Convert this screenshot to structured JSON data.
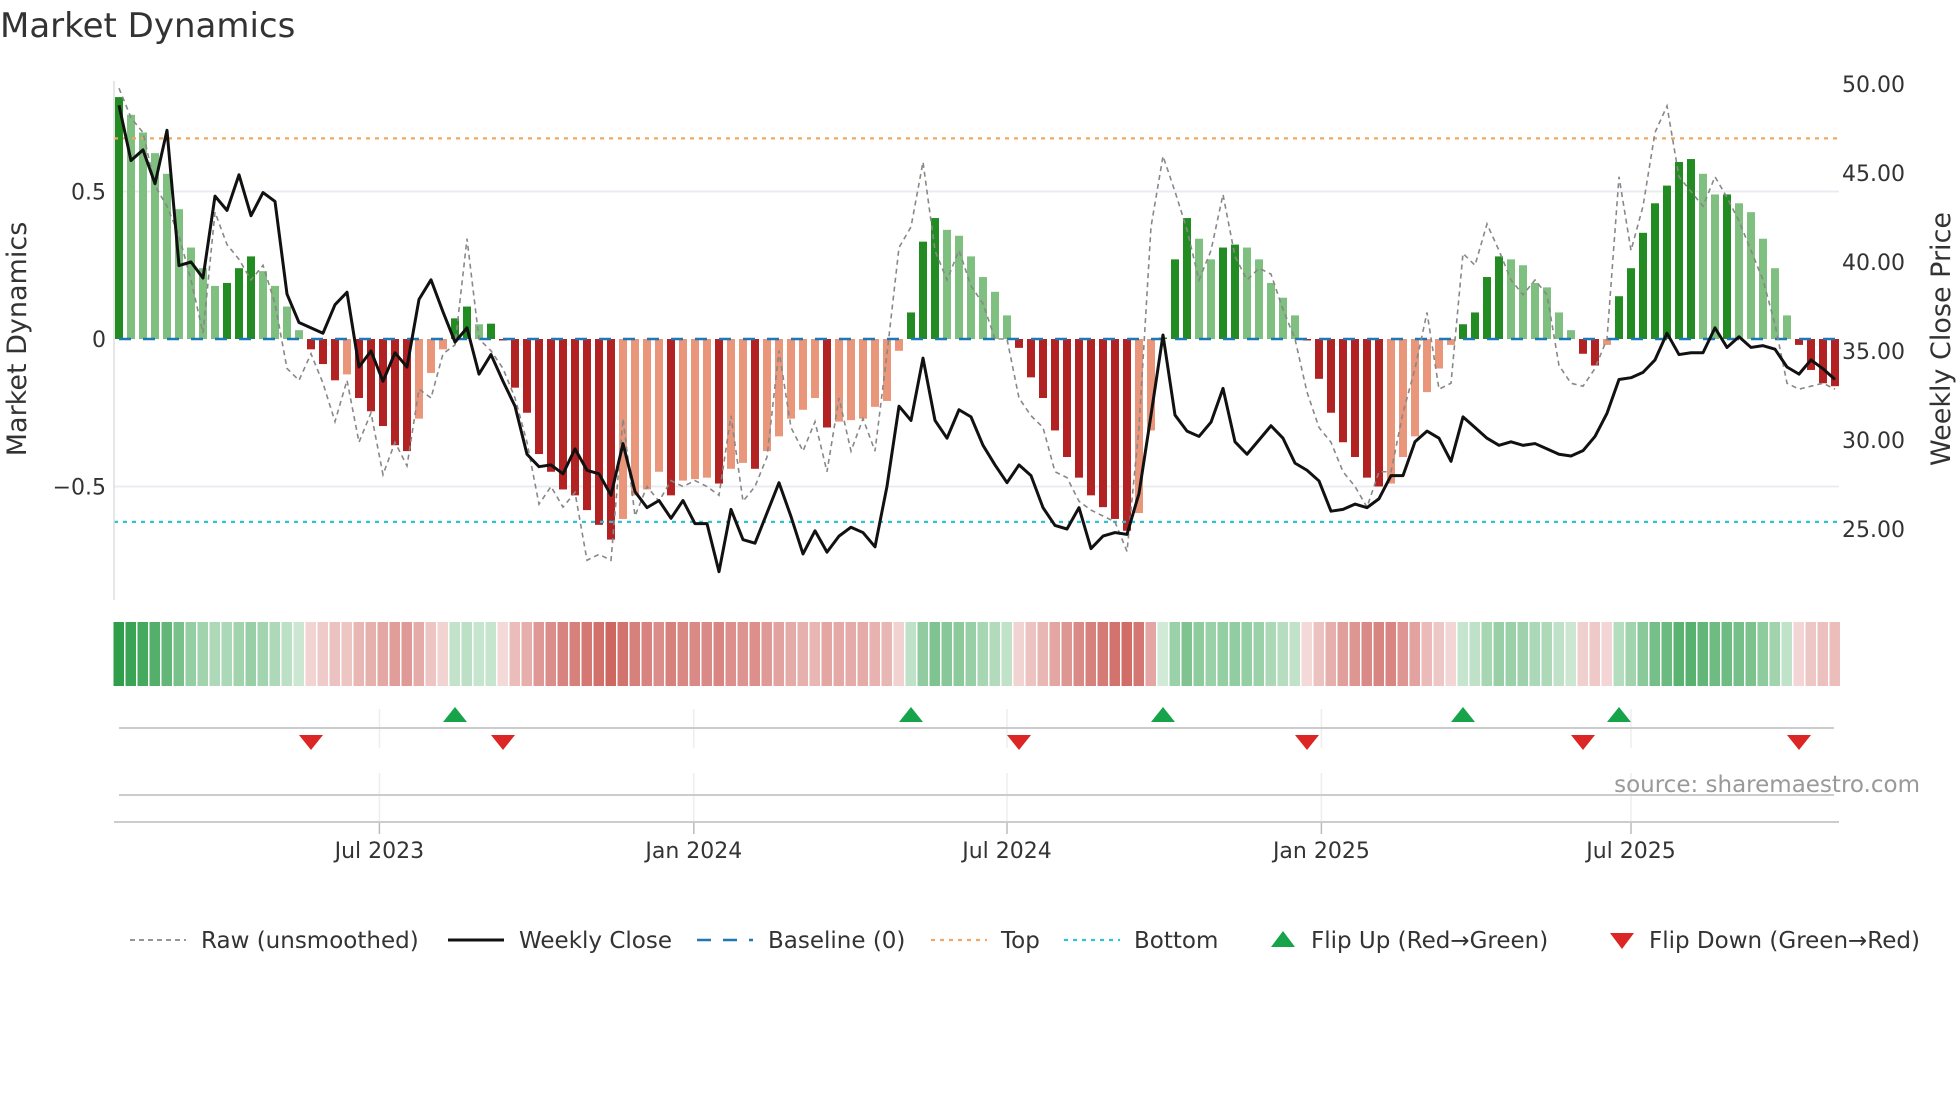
{
  "title": "Market Dynamics",
  "source": "source: sharemaestro.com",
  "colors": {
    "dark_green": "#228b22",
    "light_green": "#7fbf7f",
    "dark_red": "#b22222",
    "light_red": "#e9967a",
    "heat_green": "#2e9e4a",
    "heat_red": "#c8504a",
    "top": "#f0a860",
    "bottom": "#2ec4d6",
    "baseline": "#1f77b4",
    "flip_up": "#16a34a",
    "flip_down": "#dc2626"
  },
  "chart_data": {
    "type": "bar",
    "title": "Market Dynamics",
    "ylabel": "Market Dynamics",
    "y2label": "Weekly Close Price",
    "ylim": [
      -0.94,
      0.87
    ],
    "y2lim": [
      21.6,
      50.2
    ],
    "yticks": [
      {
        "v": 0.5,
        "label": "0.5"
      },
      {
        "v": 0,
        "label": "0"
      },
      {
        "v": -0.5,
        "label": "−0.5"
      }
    ],
    "y2ticks": [
      {
        "v": 50,
        "label": "50.00"
      },
      {
        "v": 45,
        "label": "45.00"
      },
      {
        "v": 40,
        "label": "40.00"
      },
      {
        "v": 35,
        "label": "35.00"
      },
      {
        "v": 30,
        "label": "30.00"
      },
      {
        "v": 25,
        "label": "25.00"
      }
    ],
    "xticks": [
      {
        "week": 22.7,
        "label": "Jul 2023"
      },
      {
        "week": 48.9,
        "label": "Jan 2024"
      },
      {
        "week": 75.0,
        "label": "Jul 2024"
      },
      {
        "week": 101.2,
        "label": "Jan 2025"
      },
      {
        "week": 127.0,
        "label": "Jul 2025"
      }
    ],
    "top_level": 0.68,
    "bottom_level": -0.62,
    "baseline": 0,
    "momentum": [
      0.82,
      0.76,
      0.7,
      0.63,
      0.56,
      0.44,
      0.31,
      0.24,
      0.18,
      0.19,
      0.24,
      0.28,
      0.23,
      0.18,
      0.11,
      0.03,
      -0.035,
      -0.085,
      -0.14,
      -0.12,
      -0.2,
      -0.245,
      -0.295,
      -0.36,
      -0.38,
      -0.27,
      -0.115,
      -0.035,
      0.07,
      0.11,
      0.05,
      0.052,
      -0.005,
      -0.165,
      -0.25,
      -0.39,
      -0.45,
      -0.51,
      -0.53,
      -0.58,
      -0.63,
      -0.68,
      -0.61,
      -0.53,
      -0.51,
      -0.45,
      -0.53,
      -0.48,
      -0.475,
      -0.47,
      -0.49,
      -0.44,
      -0.42,
      -0.44,
      -0.38,
      -0.33,
      -0.27,
      -0.24,
      -0.2,
      -0.3,
      -0.28,
      -0.275,
      -0.27,
      -0.23,
      -0.21,
      -0.04,
      0.09,
      0.33,
      0.41,
      0.37,
      0.35,
      0.28,
      0.21,
      0.16,
      0.08,
      -0.03,
      -0.13,
      -0.2,
      -0.31,
      -0.4,
      -0.47,
      -0.53,
      -0.57,
      -0.61,
      -0.65,
      -0.59,
      -0.31,
      0.005,
      0.27,
      0.41,
      0.34,
      0.27,
      0.31,
      0.32,
      0.31,
      0.27,
      0.19,
      0.14,
      0.08,
      -0.005,
      -0.135,
      -0.25,
      -0.35,
      -0.4,
      -0.47,
      -0.5,
      -0.49,
      -0.4,
      -0.33,
      -0.18,
      -0.1,
      -0.02,
      0.05,
      0.09,
      0.21,
      0.28,
      0.27,
      0.25,
      0.19,
      0.175,
      0.09,
      0.03,
      -0.05,
      -0.09,
      -0.02,
      0.145,
      0.24,
      0.36,
      0.46,
      0.52,
      0.6,
      0.61,
      0.56,
      0.49,
      0.49,
      0.46,
      0.43,
      0.34,
      0.24,
      0.08,
      -0.02,
      -0.105,
      -0.15,
      -0.16
    ],
    "raw": [
      0.85,
      0.75,
      0.7,
      0.52,
      0.45,
      0.35,
      0.2,
      0.02,
      0.43,
      0.32,
      0.27,
      0.2,
      0.25,
      0.12,
      -0.1,
      -0.14,
      -0.05,
      -0.15,
      -0.28,
      -0.14,
      -0.35,
      -0.25,
      -0.46,
      -0.35,
      -0.43,
      -0.17,
      -0.2,
      -0.05,
      -0.02,
      0.34,
      0.0,
      -0.04,
      -0.1,
      -0.2,
      -0.35,
      -0.56,
      -0.5,
      -0.57,
      -0.52,
      -0.75,
      -0.73,
      -0.75,
      -0.27,
      -0.6,
      -0.5,
      -0.55,
      -0.48,
      -0.5,
      -0.48,
      -0.5,
      -0.53,
      -0.26,
      -0.55,
      -0.5,
      -0.4,
      -0.04,
      -0.3,
      -0.38,
      -0.28,
      -0.45,
      -0.2,
      -0.38,
      -0.27,
      -0.38,
      -0.05,
      0.31,
      0.38,
      0.6,
      0.3,
      0.2,
      0.3,
      0.18,
      0.12,
      0.0,
      0.0,
      -0.2,
      -0.26,
      -0.3,
      -0.45,
      -0.47,
      -0.55,
      -0.58,
      -0.6,
      -0.62,
      -0.72,
      -0.3,
      0.38,
      0.62,
      0.5,
      0.37,
      0.2,
      0.3,
      0.49,
      0.28,
      0.2,
      0.24,
      0.22,
      0.1,
      0.0,
      -0.18,
      -0.3,
      -0.35,
      -0.45,
      -0.5,
      -0.57,
      -0.45,
      -0.45,
      -0.25,
      -0.1,
      0.09,
      -0.17,
      -0.15,
      0.29,
      0.25,
      0.39,
      0.3,
      0.2,
      0.15,
      0.2,
      0.15,
      -0.09,
      -0.15,
      -0.16,
      -0.1,
      0.0,
      0.55,
      0.3,
      0.45,
      0.7,
      0.79,
      0.55,
      0.5,
      0.45,
      0.55,
      0.48,
      0.4,
      0.3,
      0.2,
      0.05,
      -0.15,
      -0.17,
      -0.16,
      -0.15,
      -0.17
    ],
    "close": [
      48.8,
      45.7,
      46.3,
      44.4,
      47.4,
      39.8,
      40.0,
      39.1,
      43.7,
      42.9,
      44.9,
      42.6,
      43.9,
      43.4,
      38.2,
      36.6,
      36.3,
      36.0,
      37.6,
      38.3,
      34.1,
      35.0,
      33.3,
      34.9,
      34.1,
      37.9,
      39.0,
      37.2,
      35.5,
      36.3,
      33.7,
      34.8,
      33.3,
      31.9,
      29.2,
      28.5,
      28.6,
      28.1,
      29.5,
      28.3,
      28.1,
      26.9,
      29.8,
      27.1,
      26.2,
      26.6,
      25.6,
      26.6,
      25.3,
      25.3,
      22.6,
      26.1,
      24.4,
      24.2,
      25.9,
      27.6,
      25.7,
      23.6,
      24.9,
      23.7,
      24.6,
      25.1,
      24.8,
      24.0,
      27.4,
      31.9,
      31.1,
      34.6,
      31.1,
      30.1,
      31.7,
      31.3,
      29.7,
      28.6,
      27.6,
      28.6,
      28.0,
      26.2,
      25.2,
      25.0,
      26.2,
      23.9,
      24.6,
      24.8,
      24.7,
      27.0,
      31.4,
      35.9,
      31.4,
      30.5,
      30.2,
      31.0,
      32.9,
      29.9,
      29.2,
      30.0,
      30.8,
      30.1,
      28.7,
      28.3,
      27.7,
      26.0,
      26.1,
      26.4,
      26.2,
      26.7,
      28.0,
      28.0,
      29.9,
      30.5,
      30.1,
      28.8,
      31.3,
      30.7,
      30.1,
      29.7,
      29.9,
      29.7,
      29.8,
      29.5,
      29.2,
      29.1,
      29.4,
      30.2,
      31.5,
      33.4,
      33.5,
      33.8,
      34.5,
      36.0,
      34.8,
      34.9,
      34.9,
      36.3,
      35.2,
      35.8,
      35.2,
      35.3,
      35.1,
      34.1,
      33.7,
      34.5,
      34.0,
      33.4
    ],
    "legend": [
      {
        "key": "raw",
        "label": "Raw (unsmoothed)"
      },
      {
        "key": "close",
        "label": "Weekly Close"
      },
      {
        "key": "baseline",
        "label": "Baseline (0)"
      },
      {
        "key": "top",
        "label": "Top"
      },
      {
        "key": "bottom",
        "label": "Bottom"
      },
      {
        "key": "flip_up",
        "label": "Flip Up (Red→Green)"
      },
      {
        "key": "flip_down",
        "label": "Flip Down (Green→Red)"
      }
    ],
    "legend_position": "bottom"
  }
}
